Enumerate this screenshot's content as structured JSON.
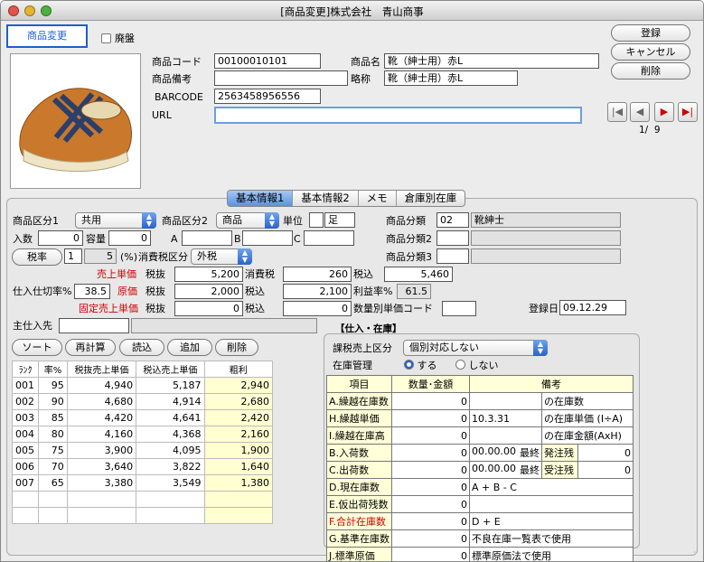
{
  "window": {
    "title": "[商品変更]株式会社　青山商事"
  },
  "mode_badge": "商品変更",
  "discontinued_label": "廃盤",
  "top_buttons": {
    "register": "登録",
    "cancel": "キャンセル",
    "delete": "削除"
  },
  "product": {
    "code_label": "商品コード",
    "code": "00100010101",
    "name_label": "商品名",
    "name": "靴（紳士用）赤L",
    "note_label": "商品備考",
    "note": "",
    "short_label": "略称",
    "short": "靴（紳士用）赤L",
    "barcode_label": "BARCODE",
    "barcode": "2563458956556",
    "url_label": "URL",
    "url": ""
  },
  "record_nav": {
    "first": "|◀",
    "prev": "◀",
    "next": "▶",
    "last": "▶|",
    "counter": "1/  9"
  },
  "tabs": [
    "基本情報1",
    "基本情報2",
    "メモ",
    "倉庫別在庫"
  ],
  "basic": {
    "cat1_label": "商品区分1",
    "cat1": "共用",
    "cat2_label": "商品区分2",
    "cat2": "商品",
    "unit_label": "単位",
    "unit": "足",
    "class_label": "商品分類",
    "class_code": "02",
    "class_name": "靴紳士",
    "class2_label": "商品分類2",
    "class2_code": "",
    "class2_name": "",
    "class3_label": "商品分類3",
    "class3_code": "",
    "class3_name": "",
    "qty_label": "入数",
    "qty": "0",
    "vol_label": "容量",
    "vol": "0",
    "a_label": "A",
    "b_label": "B",
    "c_label": "C",
    "tax_rate_btn": "税率",
    "tax_rate_a": "1",
    "tax_rate_b": "5",
    "pct_label": "(%)",
    "tax_type_label": "消費税区分",
    "tax_type": "外税",
    "sale_label": "売上単価",
    "taxless_label": "税抜",
    "sale_taxless": "5,200",
    "ctax_label": "消費税",
    "sale_ctax": "260",
    "taxin_label": "税込",
    "sale_taxin": "5,460",
    "cutrate_label": "仕入仕切率%",
    "cutrate": "38.5",
    "cost_label": "原価",
    "cost_taxless": "2,000",
    "cost_taxin": "2,100",
    "margin_label": "利益率%",
    "margin": "61.5",
    "fixed_label": "固定売上単価",
    "fixed_taxless": "0",
    "fixed_taxin": "0",
    "qtyprice_label": "数量別単価コード",
    "qtyprice": "",
    "regdate_label": "登録日",
    "regdate": "09.12.29",
    "supplier_label": "主仕入先",
    "supplier_code": "",
    "supplier_name": ""
  },
  "price_buttons": [
    "ソート",
    "再計算",
    "読込",
    "追加",
    "削除"
  ],
  "price_table": {
    "headers": [
      "ﾗﾝｸ",
      "率%",
      "税抜売上単価",
      "税込売上単価",
      "粗利"
    ],
    "rows": [
      [
        "001",
        "95",
        "4,940",
        "5,187",
        "2,940"
      ],
      [
        "002",
        "90",
        "4,680",
        "4,914",
        "2,680"
      ],
      [
        "003",
        "85",
        "4,420",
        "4,641",
        "2,420"
      ],
      [
        "004",
        "80",
        "4,160",
        "4,368",
        "2,160"
      ],
      [
        "005",
        "75",
        "3,900",
        "4,095",
        "1,900"
      ],
      [
        "006",
        "70",
        "3,640",
        "3,822",
        "1,640"
      ],
      [
        "007",
        "65",
        "3,380",
        "3,549",
        "1,380"
      ],
      [
        "",
        "",
        "",
        "",
        ""
      ],
      [
        "",
        "",
        "",
        "",
        ""
      ]
    ]
  },
  "stock": {
    "section_title": "【仕入・在庫】",
    "taxsale_label": "課税売上区分",
    "taxsale": "個別対応しない",
    "manage_label": "在庫管理",
    "manage_yes": "する",
    "manage_no": "しない",
    "headers": [
      "項目",
      "数量･金額",
      "備考"
    ],
    "rows": [
      {
        "k": "A.繰越在庫数",
        "v": "0",
        "r1": "",
        "r2": "の在庫数"
      },
      {
        "k": "H.繰越単価",
        "v": "0",
        "r1": "10.3.31",
        "r2": "の在庫単価 (I÷A)"
      },
      {
        "k": "I.繰越在庫高",
        "v": "0",
        "r1": "",
        "r2": "の在庫金額(AxH)"
      },
      {
        "k": "B.入荷数",
        "v": "0",
        "r1": "00.00.00",
        "r1b": "最終",
        "r2": "発注残",
        "r3": "0"
      },
      {
        "k": "C.出荷数",
        "v": "0",
        "r1": "00.00.00",
        "r1b": "最終",
        "r2": "受注残",
        "r3": "0"
      },
      {
        "k": "D.現在庫数",
        "v": "0",
        "note": "A + B - C"
      },
      {
        "k": "E.仮出荷残数",
        "v": "0",
        "note": ""
      },
      {
        "k": "F.合計在庫数",
        "v": "0",
        "note": "D + E"
      },
      {
        "k": "G.基準在庫数",
        "v": "0",
        "note": "不良在庫一覧表で使用"
      },
      {
        "k": "J.標準原価",
        "v": "0",
        "note": "標準原価法で使用"
      }
    ]
  },
  "colors": {
    "accent": "#1e5ed0",
    "highlight": "#ffffd2",
    "label_red": "#cc0000"
  }
}
